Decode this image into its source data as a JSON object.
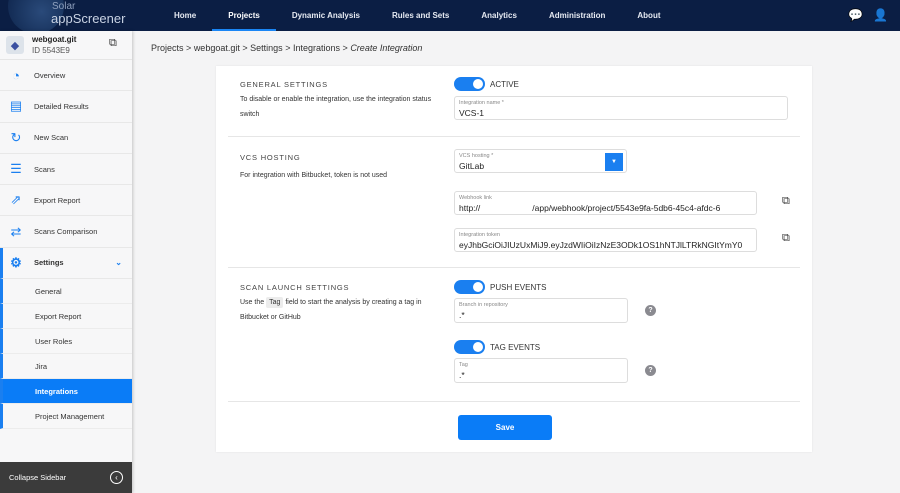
{
  "app": {
    "brand_top": "Solar",
    "brand_bottom": "appScreener"
  },
  "nav": [
    "Home",
    "Projects",
    "Dynamic Analysis",
    "Rules and Sets",
    "Analytics",
    "Administration",
    "About"
  ],
  "project": {
    "name": "webgoat.git",
    "id": "ID 5543E9"
  },
  "sidebar": {
    "items": [
      "Overview",
      "Detailed Results",
      "New Scan",
      "Scans",
      "Export Report",
      "Scans Comparison",
      "Settings"
    ],
    "sub": [
      "General",
      "Export Report",
      "User Roles",
      "Jira",
      "Integrations",
      "Project Management"
    ],
    "collapse": "Collapse Sidebar"
  },
  "breadcrumb": {
    "p1": "Projects",
    "p2": "webgoat.git",
    "p3": "Settings",
    "p4": "Integrations",
    "current": "Create Integration",
    "sep": ">"
  },
  "general": {
    "title": "GENERAL SETTINGS",
    "desc": "To disable or enable the integration, use the integration status switch",
    "toggle": "ACTIVE",
    "name_label": "Integration name *",
    "name_value": "VCS-1"
  },
  "vcs": {
    "title": "VCS HOSTING",
    "desc": "For integration with Bitbucket, token is not used",
    "hosting_label": "VCS hosting *",
    "hosting_value": "GitLab",
    "webhook_label": "Webhook link",
    "webhook_prefix": "http://",
    "webhook_value": "/app/webhook/project/5543e9fa-5db6-45c4-afdc-6",
    "token_label": "Integration token",
    "token_value": "eyJhbGciOiJIUzUxMiJ9.eyJzdWIiOiIzNzE3ODk1OS1hNTJlLTRkNGItYmY0"
  },
  "scan": {
    "title": "SCAN LAUNCH SETTINGS",
    "desc_pre": "Use the",
    "desc_chip": "Tag",
    "desc_post": "field to start the analysis by creating a tag in Bitbucket or GitHub",
    "push": "PUSH EVENTS",
    "branch_label": "Branch in repository",
    "branch_value": ".*",
    "tag_events": "TAG EVENTS",
    "tag_label": "Tag",
    "tag_value": ".*"
  },
  "save": "Save"
}
